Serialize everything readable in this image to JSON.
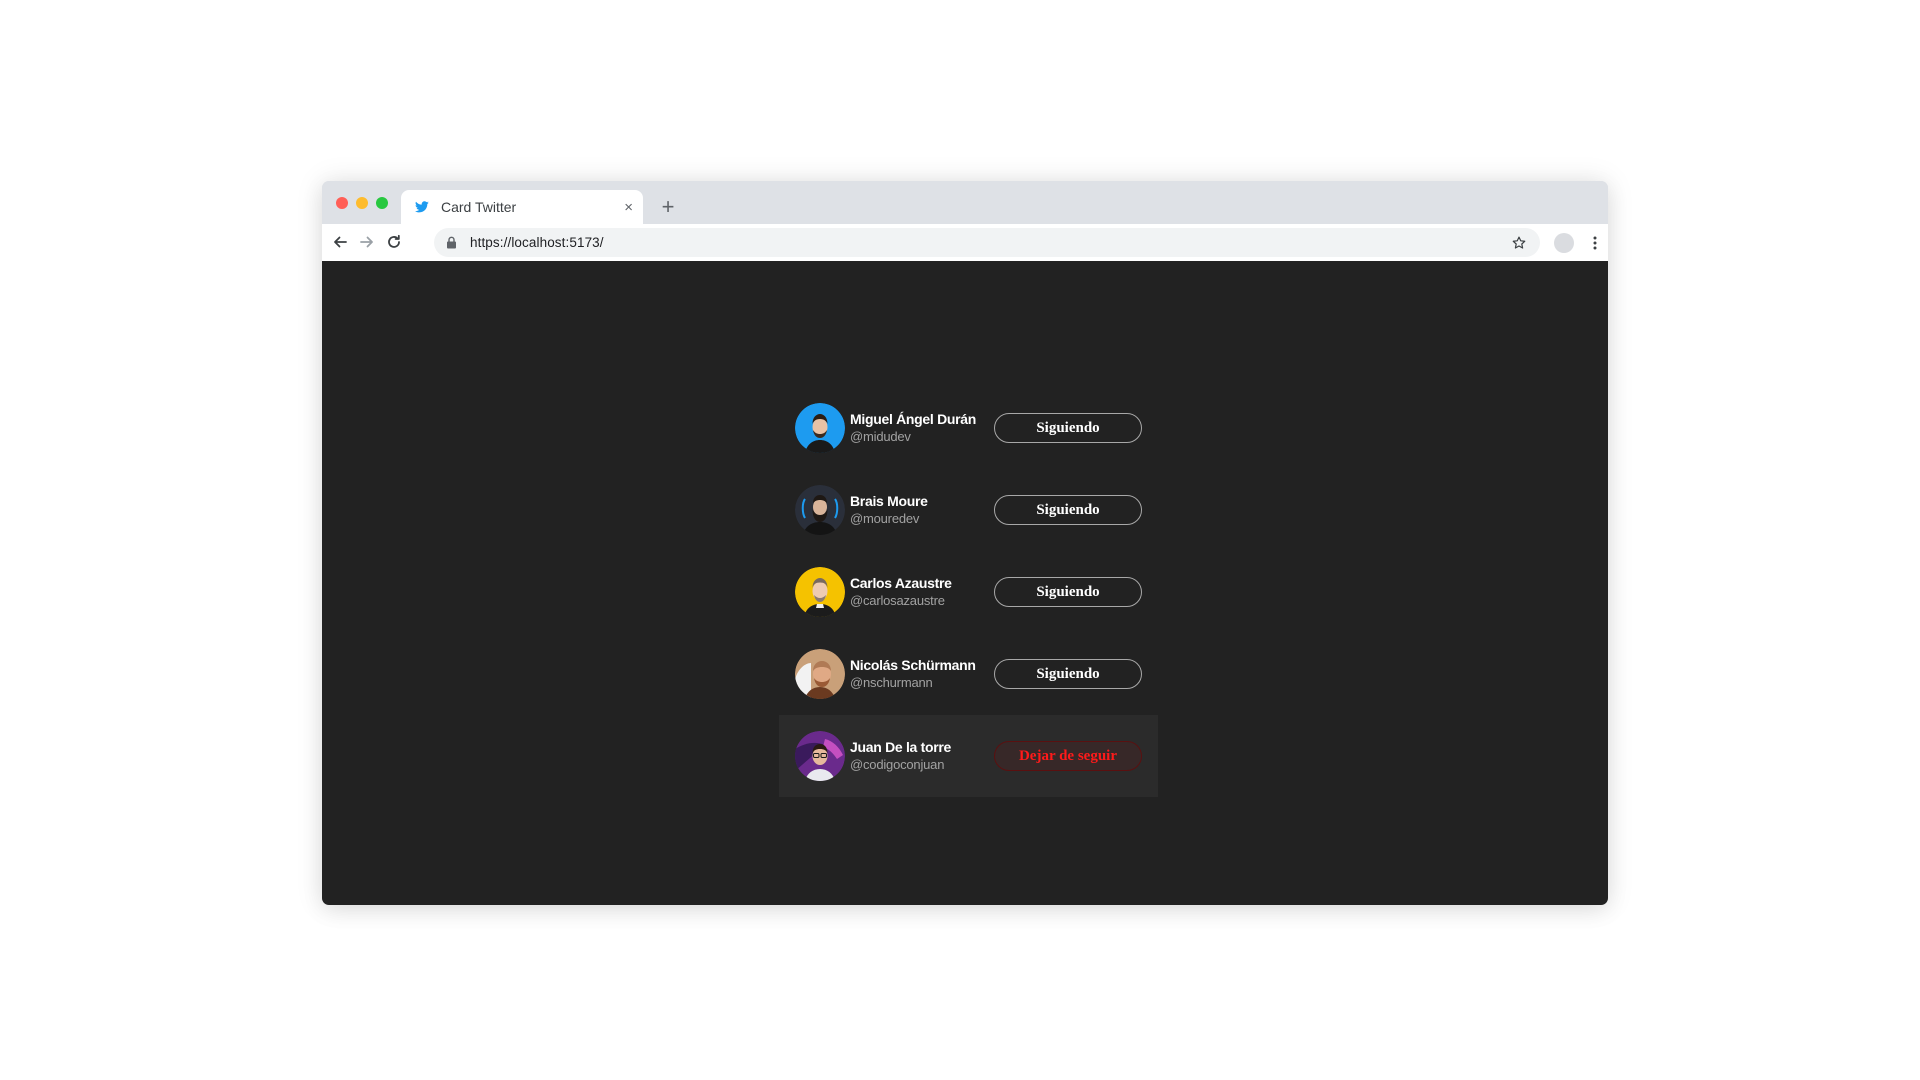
{
  "browser": {
    "tab_title": "Card Twitter",
    "tab_close": "×",
    "new_tab": "+",
    "url": "https://localhost:5173/",
    "icons": {
      "favicon": "twitter-bird-icon",
      "back": "arrow-left-icon",
      "forward": "arrow-right-icon",
      "reload": "reload-icon",
      "lock": "lock-icon",
      "bookmark": "star-icon",
      "profile": "profile-avatar-icon",
      "menu": "kebab-menu-icon"
    }
  },
  "accounts": [
    {
      "name": "Miguel Ángel Durán",
      "handle": "@midudev",
      "button": "Siguiendo",
      "avatar_bg": "#1d9bf0",
      "state": "following"
    },
    {
      "name": "Brais Moure",
      "handle": "@mouredev",
      "button": "Siguiendo",
      "avatar_bg": "#2a2f3a",
      "state": "following"
    },
    {
      "name": "Carlos Azaustre",
      "handle": "@carlosazaustre",
      "button": "Siguiendo",
      "avatar_bg": "#f5c200",
      "state": "following"
    },
    {
      "name": "Nicolás Schürmann",
      "handle": "@nschurmann",
      "button": "Siguiendo",
      "avatar_bg": "#c9a079",
      "state": "following"
    },
    {
      "name": "Juan De la torre",
      "handle": "@codigoconjuan",
      "button": "Dejar de seguir",
      "avatar_bg": "#6a2a8c",
      "state": "hover-unfollow"
    }
  ],
  "colors": {
    "page_bg": "#222222",
    "hover_row_bg": "#2b2b2b",
    "unfollow_text": "#ff1a1a",
    "twitter_blue": "#1d9bf0"
  }
}
